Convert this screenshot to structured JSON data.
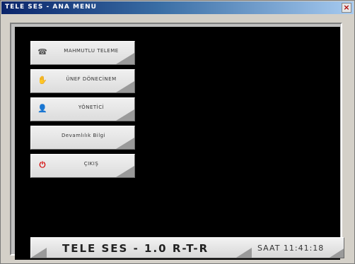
{
  "window": {
    "title": "TELE SES - ANA MENU",
    "close_glyph": "×"
  },
  "menu": {
    "items": [
      {
        "label": "MAHMUTLU TELEME",
        "icon": "phone-list-icon",
        "glyph": "☎"
      },
      {
        "label": "ÜNEF DÖNECİNEM",
        "icon": "hand-icon",
        "glyph": "✋"
      },
      {
        "label": "YÖNETİCİ",
        "icon": "user-icon",
        "glyph": "👤"
      },
      {
        "label": "Devamlılık Bilgi",
        "icon": "",
        "glyph": ""
      },
      {
        "label": "ÇIKIŞ",
        "icon": "exit-icon",
        "glyph": "⏻"
      }
    ]
  },
  "status": {
    "app_name": "TELE SES - 1.0  R-T-R",
    "clock": "SAAT 11:41:18"
  },
  "colors": {
    "title_bar_start": "#0a246a",
    "title_bar_end": "#a6caf0",
    "client_bg": "#d4d0c8",
    "main_area": "#000000",
    "button_face": "#e6e6e6",
    "exit_icon": "#d40000",
    "close_x": "#b00000"
  }
}
